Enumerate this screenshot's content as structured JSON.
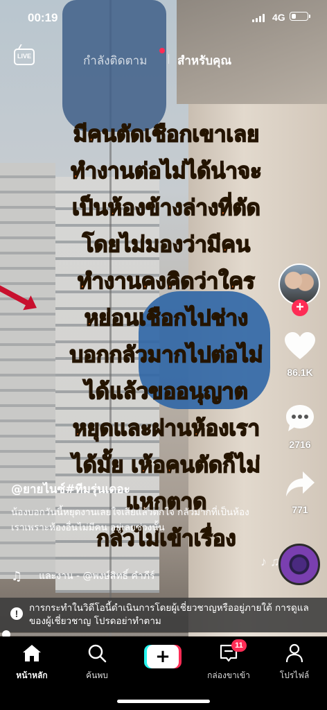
{
  "status_bar": {
    "time": "00:19",
    "network": "4G",
    "battery_level": 0.3
  },
  "top_tabs": {
    "live": "LIVE",
    "following": "กำลังติดตาม",
    "for_you": "สำหรับคุณ"
  },
  "video_text": {
    "lines": [
      "มีคนตัดเชือกเขาเลย",
      "ทำงานต่อไม่ได้น่าจะ",
      "เป็นห้องข้างล่างที่ตัด",
      "โดยไม่มองว่ามีคน",
      "ทำงานคงคิดว่าใคร",
      "หย่อนเชือกไปช่าง",
      "บอกกลัวมากไปต่อไม่",
      "ได้แล้วขออนุญาต",
      "หยุดและผ่านห้องเรา",
      "ได้มั้ย  เห้อคนตัดก็ไม่",
      "แหกตาด",
      "กลัวไม่เข้าเรื่อง"
    ]
  },
  "actions": {
    "likes": "86.1K",
    "comments": "2716",
    "shares": "771"
  },
  "post": {
    "username": "@ยายไนซ์#ทีมรุ่นเดอะ",
    "caption": "น้องบอกวันนี้หยุดงานเลยใจเสียแล้วตกใจ กลัวมากที่เป็นห้องเราเพราะห้องอื่นไม่มีคน อยู่เลยช่วงนั้น",
    "music": "และงาน - @พงษ์สิทธิ์ คำภีร์"
  },
  "warning": "การกระทำในวิดีโอนี้ดำเนินการโดยผู้เชี่ยวชาญหรืออยู่ภายใต้ การดูแลของผู้เชี่ยวชาญ โปรดอย่าทำตาม",
  "progress": 0.02,
  "nav": {
    "home": "หน้าหลัก",
    "discover": "ค้นพบ",
    "create": "+",
    "inbox": "กล่องขาเข้า",
    "inbox_badge": "11",
    "profile": "โปรไฟล์"
  },
  "colors": {
    "accent": "#fe2c55",
    "cyan": "#25f4ee",
    "overlay_text": "#f36d1c"
  }
}
